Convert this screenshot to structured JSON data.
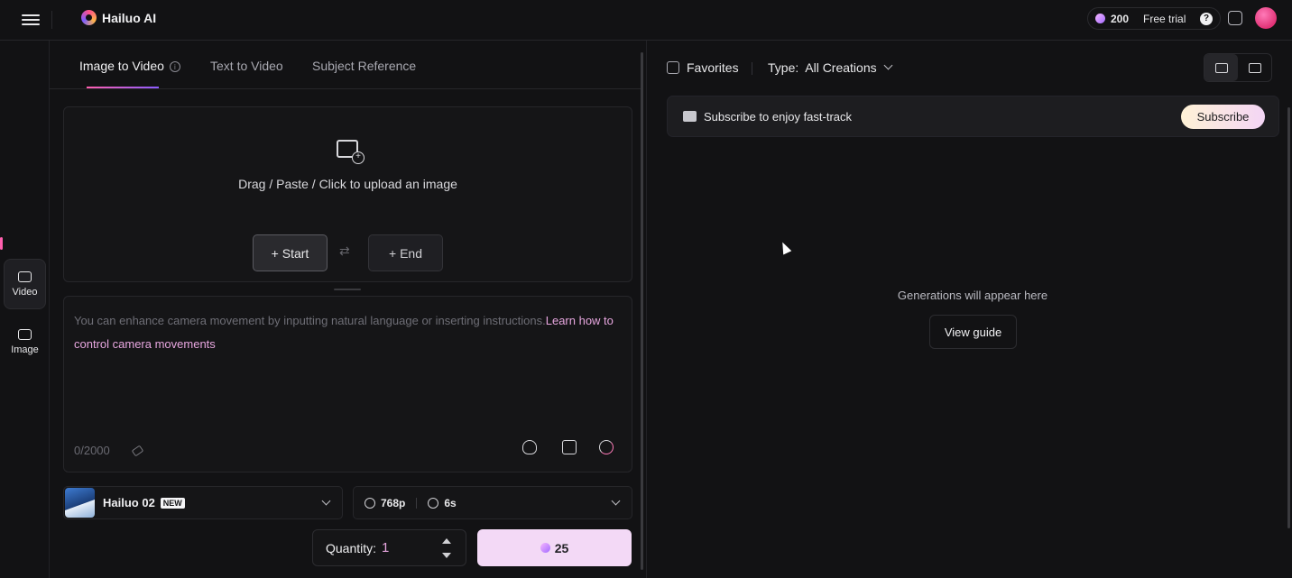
{
  "header": {
    "logo_text": "Hailuo AI",
    "credits": "200",
    "free_trial": "Free trial",
    "help": "?"
  },
  "rail": {
    "items": [
      {
        "label": "Video",
        "icon": "video-icon",
        "active": true
      },
      {
        "label": "Image",
        "icon": "image-icon",
        "active": false
      }
    ]
  },
  "tabs": [
    {
      "label": "Image to Video",
      "active": true
    },
    {
      "label": "Text to Video",
      "active": false
    },
    {
      "label": "Subject Reference",
      "active": false
    }
  ],
  "upload": {
    "hint": "Drag / Paste / Click to upload an image",
    "start_label": "+ Start",
    "end_label": "+ End"
  },
  "prompt": {
    "placeholder": "You can enhance camera movement by inputting natural language or inserting instructions.",
    "link": "Learn how to control camera movements",
    "counter": "0/2000"
  },
  "model": {
    "name": "Hailuo 02",
    "badge": "NEW"
  },
  "settings": {
    "resolution": "768p",
    "duration": "6s"
  },
  "quantity": {
    "label": "Quantity:",
    "value": "1"
  },
  "generate": {
    "cost": "25"
  },
  "right": {
    "favorites": "Favorites",
    "type_label": "Type:",
    "type_value": "All Creations",
    "banner_text": "Subscribe to enjoy fast-track",
    "subscribe": "Subscribe",
    "empty": "Generations will appear here",
    "view_guide": "View guide"
  },
  "colors": {
    "accent_pink": "#e7a6df",
    "generate_bg": "#f3d9f6",
    "background": "#121214"
  }
}
